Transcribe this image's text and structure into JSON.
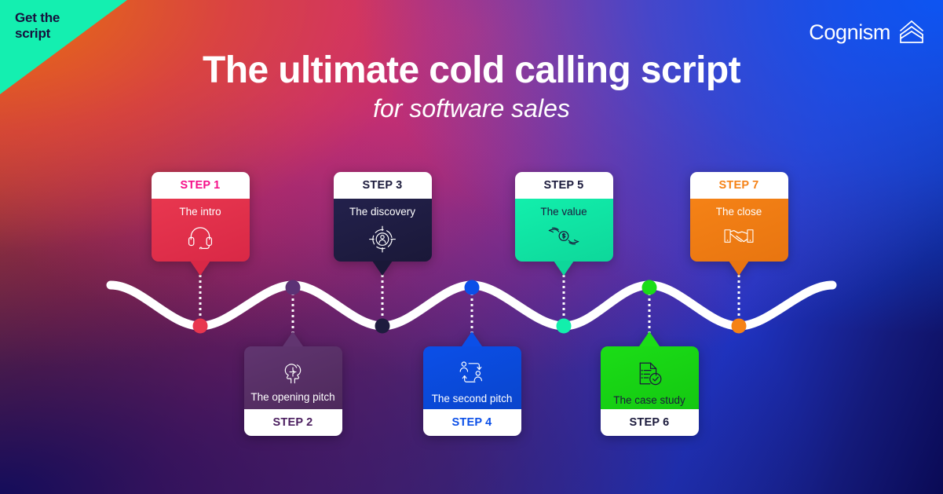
{
  "brand": {
    "logo_text": "Cognism",
    "logo_mark_icon": "stacked-chevron-mountain-icon"
  },
  "corner_flag": {
    "text": "Get the\nscript",
    "bg_color": "#14EFB0",
    "text_color": "#16113D"
  },
  "header": {
    "title": "The ultimate cold calling script",
    "subtitle": "for software sales"
  },
  "timeline": {
    "wave_color": "#FFFFFF",
    "connector_style": "dotted"
  },
  "steps": [
    {
      "label": "STEP 1",
      "title": "The intro",
      "icon": "headset-icon",
      "color": "#E8374F",
      "color_dark": "#D92846",
      "label_color": "#F5108A",
      "text_color": "#FFFFFF",
      "icon_color": "#FFFFFF",
      "position": "above",
      "node_color": "#E8374F"
    },
    {
      "label": "STEP 2",
      "title": "The opening pitch",
      "icon": "head-puzzle-icon",
      "color": "#613570",
      "color_dark": "#4E2A5C",
      "label_color": "#4A1D5E",
      "text_color": "#FFFFFF",
      "icon_color": "#FFFFFF",
      "position": "below",
      "node_color": "#5B3275"
    },
    {
      "label": "STEP 3",
      "title": "The discovery",
      "icon": "target-person-icon",
      "color": "#23214C",
      "color_dark": "#1A1838",
      "label_color": "#1B1A3C",
      "text_color": "#FFFFFF",
      "icon_color": "#FFFFFF",
      "position": "above",
      "node_color": "#1E1C3E"
    },
    {
      "label": "STEP 4",
      "title": "The second pitch",
      "icon": "two-people-exchange-icon",
      "color": "#0B4FE8",
      "color_dark": "#0A45CC",
      "label_color": "#0B4FE8",
      "text_color": "#FFFFFF",
      "icon_color": "#FFFFFF",
      "position": "below",
      "node_color": "#0B4FE8"
    },
    {
      "label": "STEP 5",
      "title": "The value",
      "icon": "hands-holding-dollar-icon",
      "color": "#12EFAC",
      "color_dark": "#0ED79A",
      "label_color": "#1B1A3C",
      "text_color": "#1B1A3C",
      "icon_color": "#1B1A3C",
      "position": "above",
      "node_color": "#12EFAC"
    },
    {
      "label": "STEP 6",
      "title": "The case study",
      "icon": "document-check-icon",
      "color": "#1BDD17",
      "color_dark": "#14C811",
      "label_color": "#1B1A3C",
      "text_color": "#1B1A3C",
      "icon_color": "#1B1A3C",
      "position": "below",
      "node_color": "#1BDD17"
    },
    {
      "label": "STEP 7",
      "title": "The close",
      "icon": "handshake-icon",
      "color": "#F58216",
      "color_dark": "#E87510",
      "label_color": "#F58216",
      "text_color": "#FFFFFF",
      "icon_color": "#FFFFFF",
      "position": "above",
      "node_color": "#F58216"
    }
  ]
}
